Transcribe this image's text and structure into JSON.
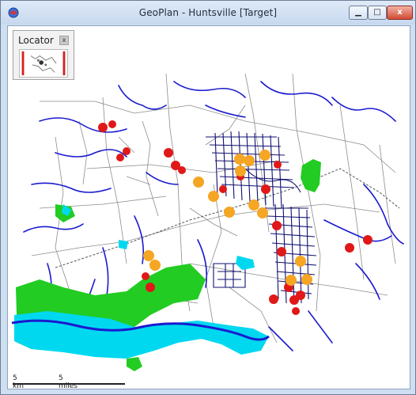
{
  "window": {
    "title": "GeoPlan - Huntsville [Target]",
    "minimize_glyph": "▁",
    "maximize_glyph": "□",
    "close_glyph": "x"
  },
  "locator": {
    "title": "Locator",
    "close_glyph": "x"
  },
  "scale": {
    "km_label": "5 km",
    "miles_label": "5 miles"
  },
  "colors": {
    "rivers": "#1a1acf",
    "urban_network": "#101070",
    "roads": "#8c8c8c",
    "flood_green": "#22cc22",
    "flood_cyan": "#00d8f0",
    "marker_red": "#e01818",
    "marker_orange": "#f5a623"
  },
  "icons": [
    "app-icon",
    "minimize-icon",
    "maximize-icon",
    "close-icon",
    "locator-close-icon"
  ]
}
